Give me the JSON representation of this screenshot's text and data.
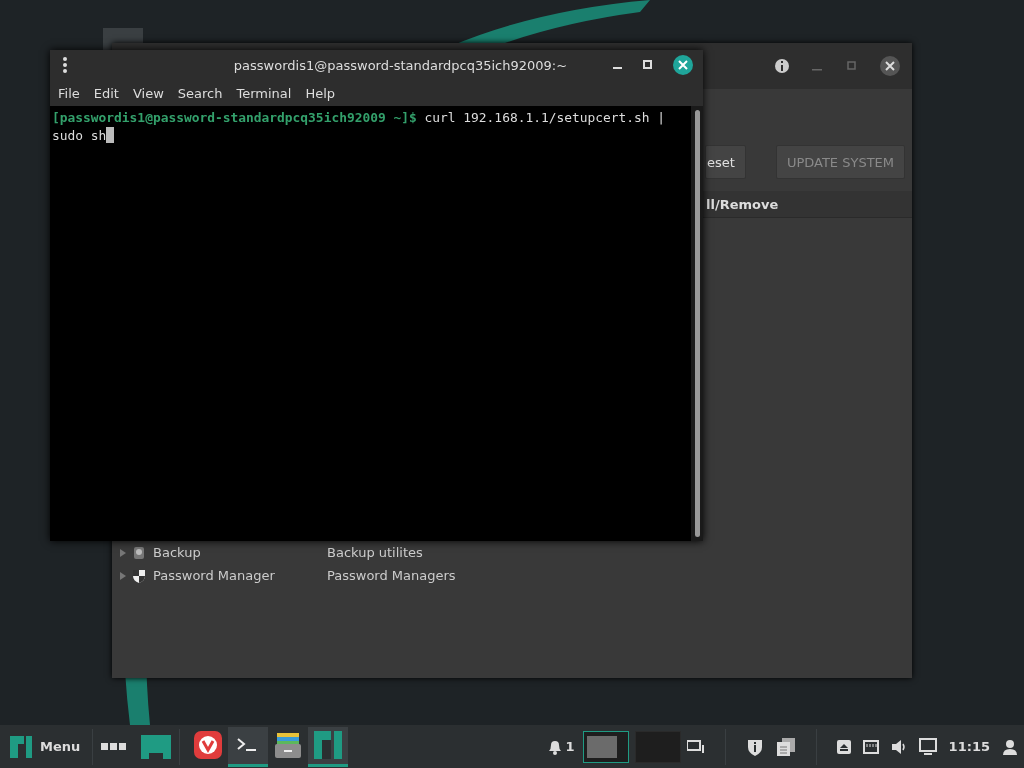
{
  "back_window": {
    "buttons": [
      {
        "label": "eset",
        "disabled": false
      },
      {
        "label": "UPDATE SYSTEM",
        "disabled": true
      }
    ],
    "column_header": "ll/Remove",
    "rows": [
      {
        "name": "Backup",
        "description": "Backup utilites",
        "expanded": false,
        "kind": "backup"
      },
      {
        "name": "Password Manager",
        "description": "Password Managers",
        "expanded": false,
        "kind": "shield"
      }
    ]
  },
  "terminal": {
    "title": "passwordis1@password-standardpcq35ich92009:~",
    "menu": [
      "File",
      "Edit",
      "View",
      "Search",
      "Terminal",
      "Help"
    ],
    "lines": [
      {
        "prompt": "[passwordis1@password-standardpcq35ich92009 ~]$",
        "text": " curl 192.168.1.1/setupcert.sh |"
      },
      {
        "text": "sudo sh"
      }
    ]
  },
  "taskbar": {
    "menu_label": "Menu",
    "launchers": [
      {
        "kind": "browser",
        "active": false
      },
      {
        "kind": "terminal",
        "active": true
      },
      {
        "kind": "files",
        "active": false
      },
      {
        "kind": "logo",
        "active": true
      }
    ],
    "notification_count": "1",
    "workspaces": [
      {
        "selected": true
      },
      {
        "selected": false
      }
    ],
    "clock": "11:15"
  }
}
